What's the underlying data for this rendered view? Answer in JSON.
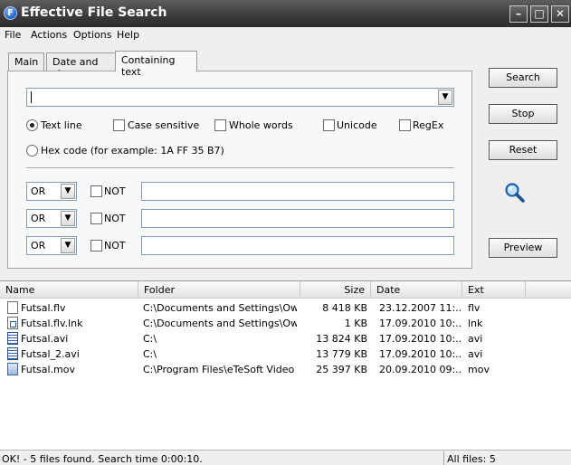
{
  "window": {
    "title": "Effective File Search",
    "icon_letter": "F"
  },
  "title_buttons": {
    "minimize": "–",
    "maximize": "□",
    "close": "✕"
  },
  "menu": [
    "File",
    "Actions",
    "Options",
    "Help"
  ],
  "tabs": [
    {
      "label": "Main",
      "active": false
    },
    {
      "label": "Date and size",
      "active": false
    },
    {
      "label": "Containing text",
      "active": true
    }
  ],
  "containing_text": {
    "search_text": "",
    "options": {
      "text_line": "Text line",
      "case_sensitive": "Case sensitive",
      "whole_words": "Whole words",
      "unicode": "Unicode",
      "regex": "RegEx",
      "hex_code": "Hex code (for example: 1A FF 35 B7)"
    },
    "conditions": [
      {
        "operator": "OR",
        "not_label": "NOT",
        "value": ""
      },
      {
        "operator": "OR",
        "not_label": "NOT",
        "value": ""
      },
      {
        "operator": "OR",
        "not_label": "NOT",
        "value": ""
      }
    ]
  },
  "buttons": {
    "search": "Search",
    "stop": "Stop",
    "reset": "Reset",
    "preview": "Preview"
  },
  "results": {
    "columns": [
      "Name",
      "Folder",
      "Size",
      "Date",
      "Ext"
    ],
    "rows": [
      {
        "icon": "text-file-icon",
        "name": "Futsal.flv",
        "folder": "C:\\Documents and Settings\\Ow...",
        "size": "8 418 KB",
        "date": "23.12.2007 11:...",
        "ext": "flv"
      },
      {
        "icon": "shortcut-file-icon",
        "name": "Futsal.flv.lnk",
        "folder": "C:\\Documents and Settings\\Ow...",
        "size": "1 KB",
        "date": "17.09.2010 10:...",
        "ext": "lnk"
      },
      {
        "icon": "video-file-icon",
        "name": "Futsal.avi",
        "folder": "C:\\",
        "size": "13 824 KB",
        "date": "17.09.2010 10:...",
        "ext": "avi"
      },
      {
        "icon": "video-file-icon",
        "name": "Futsal_2.avi",
        "folder": "C:\\",
        "size": "13 779 KB",
        "date": "17.09.2010 10:...",
        "ext": "avi"
      },
      {
        "icon": "quicktime-file-icon",
        "name": "Futsal.mov",
        "folder": "C:\\Program Files\\eTeSoft Video ...",
        "size": "25 397 KB",
        "date": "20.09.2010 09:...",
        "ext": "mov"
      }
    ]
  },
  "status": {
    "message": "OK! - 5 files found. Search time 0:00:10.",
    "all_files": "All files: 5"
  }
}
